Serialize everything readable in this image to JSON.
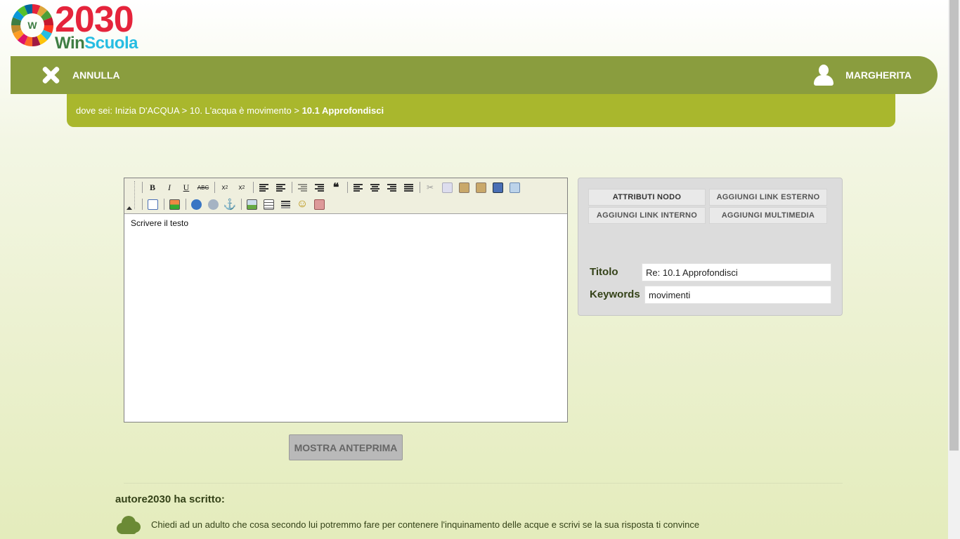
{
  "logo": {
    "year": "2030",
    "brand_a": "Win",
    "brand_b": "Scuola",
    "wheel_letter": "W"
  },
  "topbar": {
    "cancel_label": "ANNULLA",
    "user_label": "MARGHERITA"
  },
  "breadcrumb": {
    "prefix": "dove sei:",
    "items": [
      "Inizia D'ACQUA",
      "10. L'acqua è movimento"
    ],
    "separator": ">",
    "current": "10.1 Approfondisci"
  },
  "editor": {
    "content": "Scrivere il testo"
  },
  "preview_button": "MOSTRA ANTEPRIMA",
  "panel": {
    "buttons": [
      "ATTRIBUTI NODO",
      "AGGIUNGI LINK ESTERNO",
      "AGGIUNGI LINK INTERNO",
      "AGGIUNGI MULTIMEDIA"
    ],
    "title_label": "Titolo",
    "title_value": "Re: 10.1 Approfondisci",
    "keywords_label": "Keywords",
    "keywords_value": "movimenti"
  },
  "message": {
    "author": "autore2030 ha scritto:",
    "text": "Chiedi ad un adulto che cosa secondo lui potremmo fare per contenere l'inquinamento delle acque e scrivi se la sua risposta ti convince"
  },
  "colors": {
    "topbar": "#8a9d3e",
    "breadcrumb": "#a9b72d",
    "logo_red": "#e5243b",
    "logo_green": "#3f7e44"
  }
}
